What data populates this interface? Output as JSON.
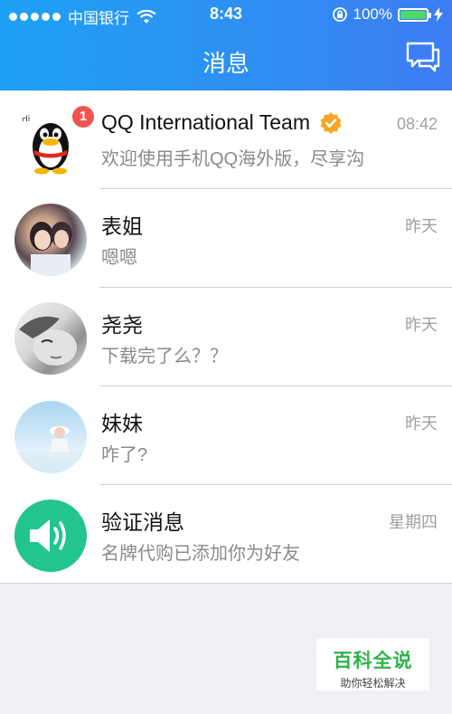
{
  "status_bar": {
    "carrier": "中国银行",
    "time": "8:43",
    "battery": "100%"
  },
  "nav": {
    "title": "消息"
  },
  "conversations": [
    {
      "name": "QQ International Team",
      "preview": "欢迎使用手机QQ海外版，尽享沟",
      "time": "08:42",
      "badge": "1",
      "verified": true
    },
    {
      "name": "表姐",
      "preview": "嗯嗯",
      "time": "昨天"
    },
    {
      "name": "尧尧",
      "preview": "下载完了么？？",
      "time": "昨天"
    },
    {
      "name": "妹妹",
      "preview": "咋了?",
      "time": "昨天"
    },
    {
      "name": "验证消息",
      "preview": "名牌代购已添加你为好友",
      "time": "星期四"
    }
  ],
  "watermark": {
    "title": "百科全说",
    "subtitle": "助你轻松解决"
  },
  "colors": {
    "header": "#2e8ff3",
    "badge": "#f2534f",
    "verify_icon": "#22c58b",
    "battery": "#4cd964"
  }
}
